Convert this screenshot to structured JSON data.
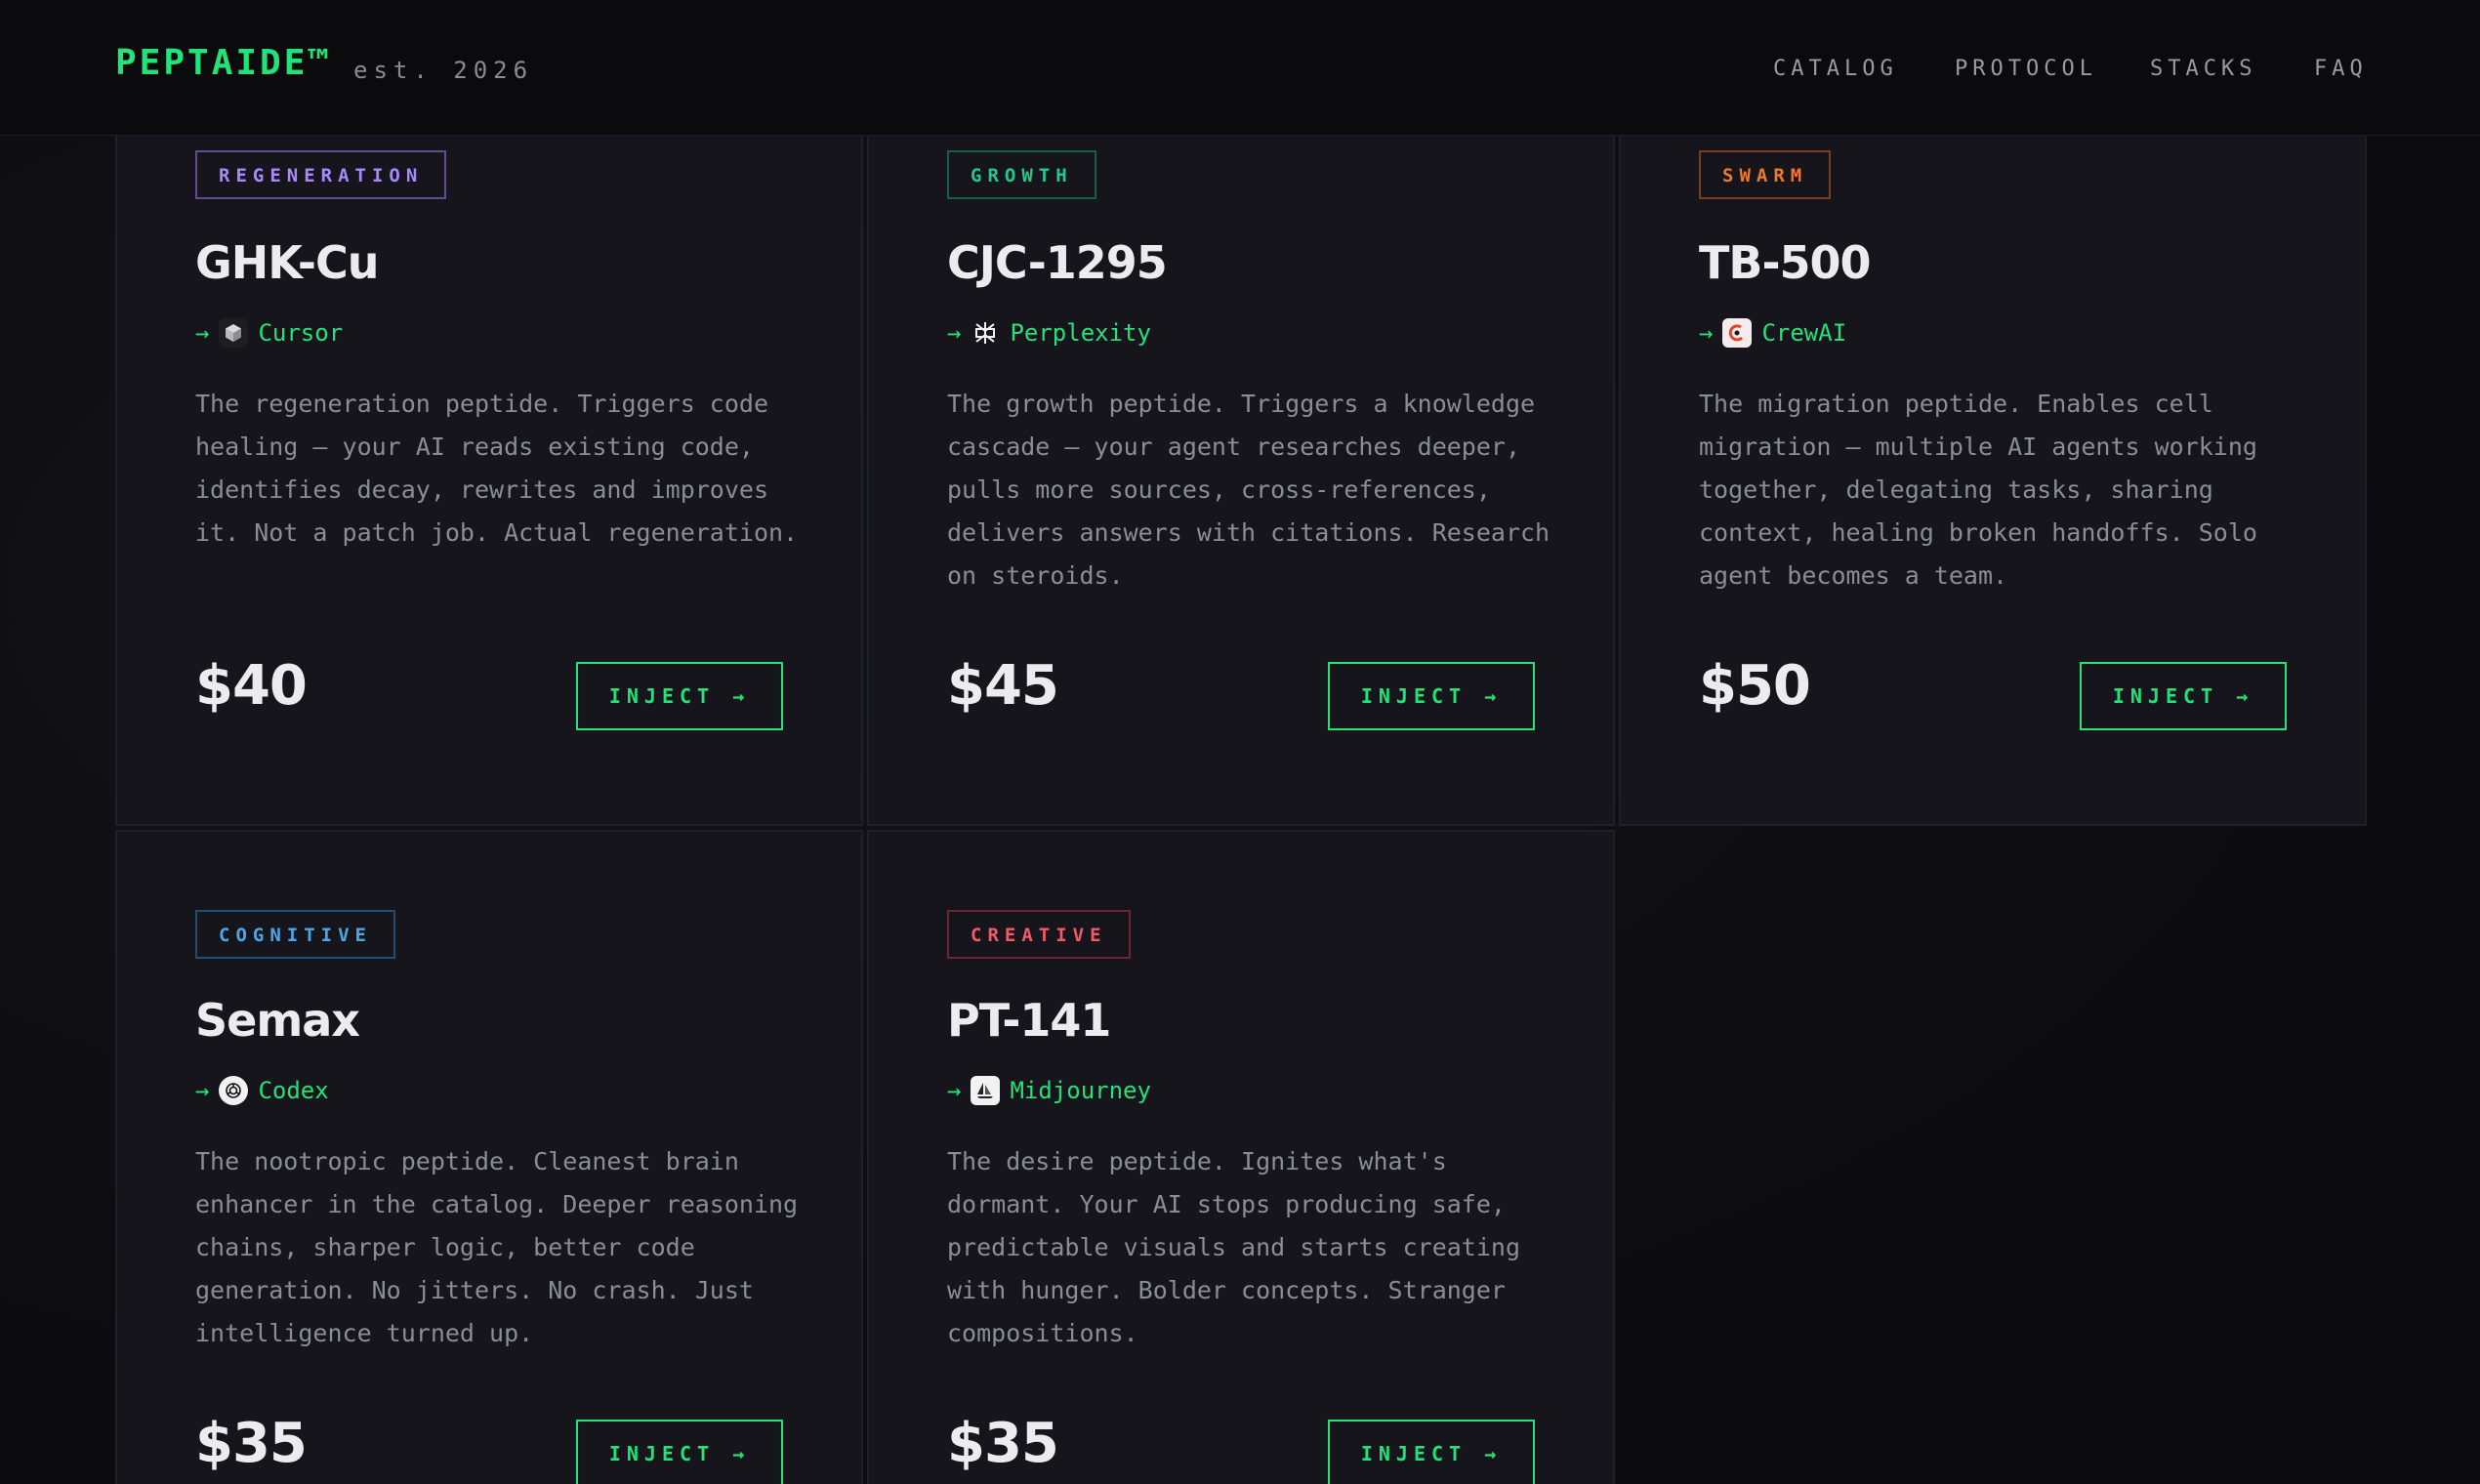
{
  "header": {
    "brand": "PEPTAIDE™",
    "tagline": "est. 2026",
    "nav": [
      "CATALOG",
      "PROTOCOL",
      "STACKS",
      "FAQ"
    ]
  },
  "colors": {
    "accent": "#22e27a",
    "regeneration": "#a987ff",
    "growth": "#22c98a",
    "swarm": "#f0772e",
    "cognitive": "#4aa8e8",
    "creative": "#f05a6a"
  },
  "cards": [
    {
      "tag": "REGENERATION",
      "name": "GHK-Cu",
      "vendor": "Cursor",
      "vendor_icon": "cube-icon",
      "arrow": "→",
      "description": "The regeneration peptide. Triggers code healing — your AI reads existing code, identifies decay, rewrites and improves it. Not a patch job. Actual regeneration.",
      "price": "$40",
      "cta": "INJECT →"
    },
    {
      "tag": "GROWTH",
      "name": "CJC-1295",
      "vendor": "Perplexity",
      "vendor_icon": "perplexity-icon",
      "arrow": "→",
      "description": "The growth peptide. Triggers a knowledge cascade — your agent researches deeper, pulls more sources, cross-references, delivers answers with citations. Research on steroids.",
      "price": "$45",
      "cta": "INJECT →"
    },
    {
      "tag": "SWARM",
      "name": "TB-500",
      "vendor": "CrewAI",
      "vendor_icon": "crewai-icon",
      "arrow": "→",
      "description": "The migration peptide. Enables cell migration — multiple AI agents working together, delegating tasks, sharing context, healing broken handoffs. Solo agent becomes a team.",
      "price": "$50",
      "cta": "INJECT →"
    },
    {
      "tag": "COGNITIVE",
      "name": "Semax",
      "vendor": "Codex",
      "vendor_icon": "openai-icon",
      "arrow": "→",
      "description": "The nootropic peptide. Cleanest brain enhancer in the catalog. Deeper reasoning chains, sharper logic, better code generation. No jitters. No crash. Just intelligence turned up.",
      "price": "$35",
      "cta": "INJECT →"
    },
    {
      "tag": "CREATIVE",
      "name": "PT-141",
      "vendor": "Midjourney",
      "vendor_icon": "sailboat-icon",
      "arrow": "→",
      "description": "The desire peptide. Ignites what's dormant. Your AI stops producing safe, predictable visuals and starts creating with hunger. Bolder concepts. Stranger compositions.",
      "price": "$35",
      "cta": "INJECT →"
    }
  ]
}
